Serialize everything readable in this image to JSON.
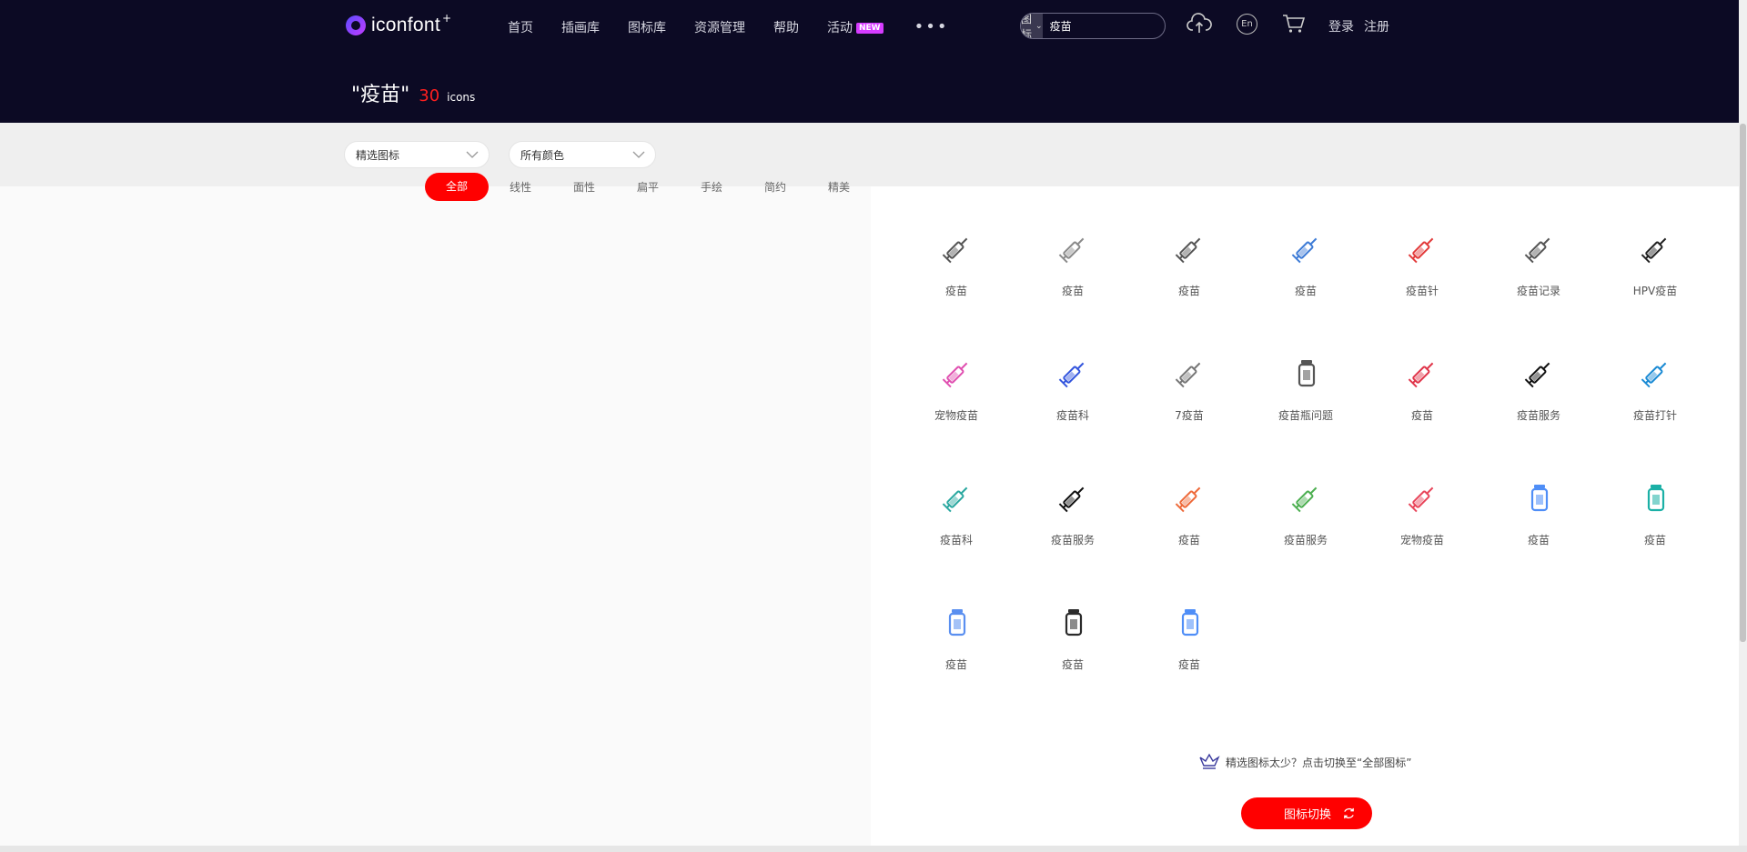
{
  "header": {
    "logo_text": "iconfont",
    "logo_plus": "+",
    "nav": [
      "首页",
      "插画库",
      "图标库",
      "资源管理",
      "帮助"
    ],
    "activity_label": "活动",
    "activity_badge": "NEW",
    "more_label": "•••",
    "search": {
      "type_label": "图标",
      "value": "疫苗"
    },
    "lang_label": "En",
    "login_label": "登录",
    "register_label": "注册"
  },
  "result": {
    "query": "\"疫苗\"",
    "count": "30",
    "unit": "icons"
  },
  "filters": {
    "featured_label": "精选图标",
    "color_label": "所有颜色",
    "style_tabs": [
      "全部",
      "线性",
      "面性",
      "扁平",
      "手绘",
      "简约",
      "精美"
    ]
  },
  "icons": [
    {
      "label": "疫苗",
      "icon": "syringe-smile-icon",
      "color": "#555555"
    },
    {
      "label": "疫苗",
      "icon": "syringe-shield-icon",
      "color": "#8a8a8a"
    },
    {
      "label": "疫苗",
      "icon": "syringe-small-icon",
      "color": "#555555"
    },
    {
      "label": "疫苗",
      "icon": "syringe-blue-icon",
      "color": "#3d7bd6"
    },
    {
      "label": "疫苗针",
      "icon": "vaccine-needle-icon",
      "color": "#e23b3b"
    },
    {
      "label": "疫苗记录",
      "icon": "vaccine-record-icon",
      "color": "#555555"
    },
    {
      "label": "HPV疫苗",
      "icon": "hpv-vaccine-icon",
      "color": "#222222"
    },
    {
      "label": "疫苗",
      "icon": "syringe-partial-icon",
      "color": "#999999"
    },
    {
      "label": "宠物疫苗",
      "icon": "pet-vaccine-icon",
      "color": "#e04fb0"
    },
    {
      "label": "疫苗科",
      "icon": "syringe-outline-blue-icon",
      "color": "#3355dd"
    },
    {
      "label": "7疫苗",
      "icon": "syringe-seven-icon",
      "color": "#777777"
    },
    {
      "label": "疫苗瓶问题",
      "icon": "vaccine-bottle-problem-icon",
      "color": "#555555"
    },
    {
      "label": "疫苗",
      "icon": "syringe-red-liquid-icon",
      "color": "#e0354a"
    },
    {
      "label": "疫苗服务",
      "icon": "syringe-black-icon",
      "color": "#111111"
    },
    {
      "label": "疫苗打针",
      "icon": "syringe-injection-icon",
      "color": "#1a8ad4"
    },
    {
      "label": "",
      "icon": "syringe-partial-icon",
      "color": "#999999"
    },
    {
      "label": "疫苗科",
      "icon": "syringe-teal-icon",
      "color": "#2aa8a0"
    },
    {
      "label": "疫苗服务",
      "icon": "syringe-bold-icon",
      "color": "#111111"
    },
    {
      "label": "疫苗",
      "icon": "syringe-orange-icon",
      "color": "#ee6a3a"
    },
    {
      "label": "疫苗服务",
      "icon": "syringe-green-icon",
      "color": "#4caf50"
    },
    {
      "label": "宠物疫苗",
      "icon": "syringe-pink-icon",
      "color": "#e8455a"
    },
    {
      "label": "疫苗",
      "icon": "vaccine-bottle-blue-icon",
      "color": "#4f8ef7"
    },
    {
      "label": "疫苗",
      "icon": "vaccine-bottle-teal-icon",
      "color": "#1bb0a6"
    },
    {
      "label": "",
      "icon": "vaccine-bottle-orange-icon",
      "color": "#f0a030"
    },
    {
      "label": "疫苗",
      "icon": "vaccine-bottle-outline-icon",
      "color": "#5a8ff0"
    },
    {
      "label": "疫苗",
      "icon": "vaccine-bottle-dark-icon",
      "color": "#2b2b2b"
    },
    {
      "label": "疫苗",
      "icon": "vaccine-bottle-solid-blue-icon",
      "color": "#4f8ef7"
    }
  ],
  "hint": {
    "text": "精选图标太少？点击切换至“全部图标”"
  },
  "switch_button": {
    "label": "图标切换"
  },
  "colors": {
    "header_bg": "#0c0a24",
    "accent": "#ff0000",
    "badge": "#d63cff"
  }
}
